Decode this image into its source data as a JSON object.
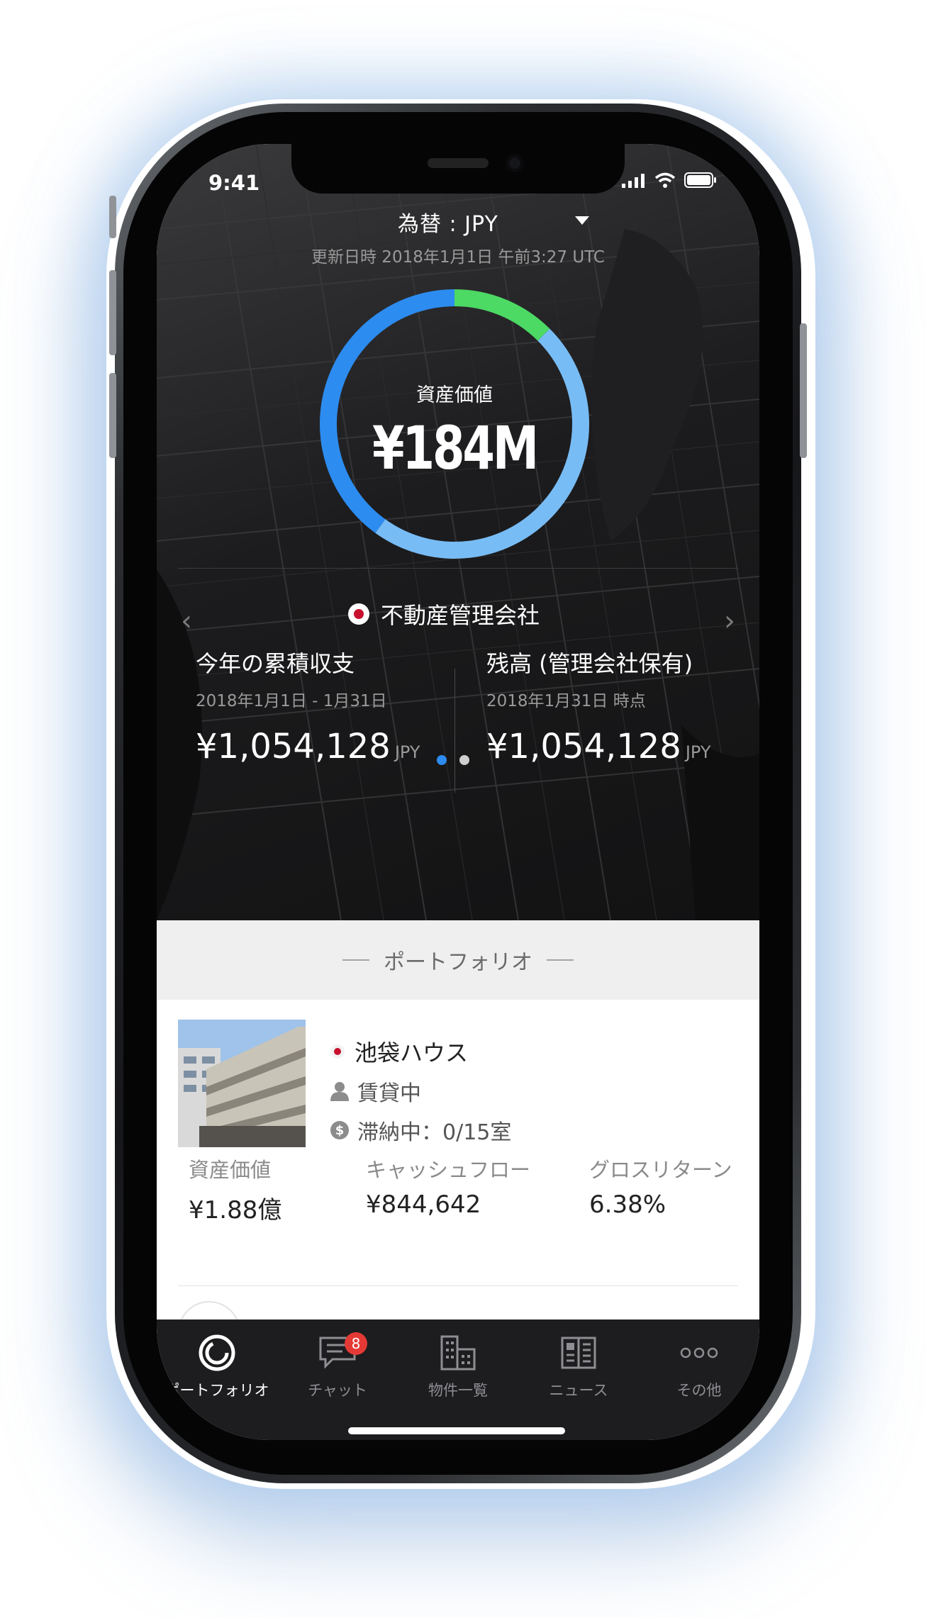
{
  "status_bar": {
    "time": "9:41"
  },
  "header": {
    "currency_label": "為替 : JPY",
    "updated": "更新日時 2018年1月1日 午前3:27 UTC"
  },
  "summary": {
    "label": "資産価値",
    "value": "¥184M",
    "ring_segments": [
      {
        "name": "green",
        "fraction": 0.125,
        "color": "#4cd964"
      },
      {
        "name": "light-blue",
        "fraction": 0.475,
        "color": "#78bcf5"
      },
      {
        "name": "blue",
        "fraction": 0.4,
        "color": "#2d8cf0"
      }
    ]
  },
  "company": {
    "name": "不動産管理会社"
  },
  "stats": {
    "left": {
      "title": "今年の累積収支",
      "date": "2018年1月1日 - 1月31日",
      "value": "¥1,054,128",
      "unit": "JPY"
    },
    "right": {
      "title": "残高 (管理会社保有)",
      "date": "2018年1月31日 時点",
      "value": "¥1,054,128",
      "unit": "JPY"
    }
  },
  "section_title": "ポートフォリオ",
  "property": {
    "name": "池袋ハウス",
    "status": "賃貸中",
    "arrears": "滞納中：0/15室",
    "metrics": {
      "asset_label": "資産価値",
      "asset_value": "¥1.88億",
      "cashflow_label": "キャッシュフロー",
      "cashflow_value": "¥844,642",
      "gross_label": "グロスリターン",
      "gross_value": "6.38%"
    }
  },
  "tabs": [
    {
      "label": "ポートフォリオ",
      "icon": "donut-icon"
    },
    {
      "label": "チャット",
      "icon": "chat-icon",
      "badge": "8"
    },
    {
      "label": "物件一覧",
      "icon": "building-icon"
    },
    {
      "label": "ニュース",
      "icon": "news-icon"
    },
    {
      "label": "その他",
      "icon": "more-icon"
    }
  ],
  "colors": {
    "accent_blue": "#2d8cf0",
    "green": "#4cd964",
    "light_blue": "#78bcf5",
    "badge_red": "#e53935"
  }
}
